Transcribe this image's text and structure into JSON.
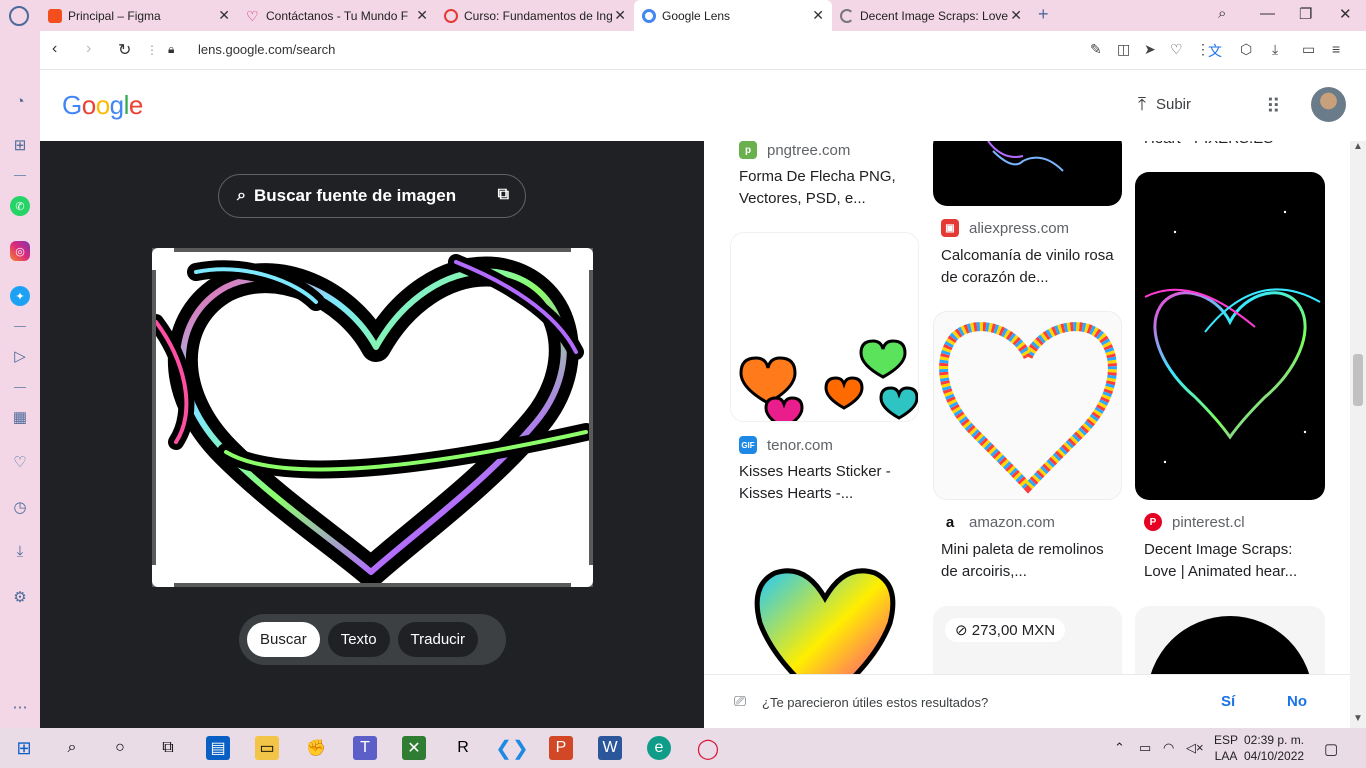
{
  "tabs": [
    {
      "title": "Principal – Figma",
      "icon": "figma-icon",
      "color": "#f24e1e"
    },
    {
      "title": "Contáctanos - Tu Mundo F",
      "icon": "heart-icon",
      "color": "#c2185b"
    },
    {
      "title": "Curso: Fundamentos de Ing",
      "icon": "circle-icon",
      "color": "#e53935"
    },
    {
      "title": "Google Lens",
      "icon": "google-lens-icon",
      "color": "#4285f4"
    },
    {
      "title": "Decent Image Scraps: Love",
      "icon": "loading-icon",
      "color": "#777777"
    }
  ],
  "address": {
    "url": "lens.google.com/search"
  },
  "header": {
    "logo": "Google",
    "upload_label": "Subir"
  },
  "lens": {
    "source_button": "Buscar fuente de imagen",
    "modes": [
      "Buscar",
      "Texto",
      "Traducir"
    ],
    "selected_mode": "Buscar"
  },
  "results": [
    {
      "site": "pngtree.com",
      "title": "Forma De Flecha PNG, Vectores, PSD, e...",
      "fav_color": "#6ab04c"
    },
    {
      "site": "aliexpress.com",
      "title": "Calcomanía de vinilo rosa de corazón de...",
      "fav_color": "#e53935"
    },
    {
      "site": "tenor.com",
      "title": "Kisses Hearts Sticker - Kisses Hearts -...",
      "fav_color": "#1e88e5",
      "fav_text": "GIF"
    },
    {
      "site": "amazon.com",
      "title": "Mini paleta de remolinos de arcoiris,...",
      "fav_color": "#111111",
      "fav_text": "a"
    },
    {
      "site": "pinterest.cl",
      "title": "Decent Image Scraps: Love | Animated hear...",
      "fav_color": "#e60023",
      "fav_text": "P"
    },
    {
      "partial_title": "Heart - PIXERS.ES"
    }
  ],
  "price_badge": "273,00 MXN",
  "feedback": {
    "question": "¿Te parecieron útiles estos resultados?",
    "yes": "Sí",
    "no": "No"
  },
  "taskbar": {
    "lang1": "ESP",
    "lang2": "LAA",
    "time": "02:39 p. m.",
    "date": "04/10/2022"
  }
}
